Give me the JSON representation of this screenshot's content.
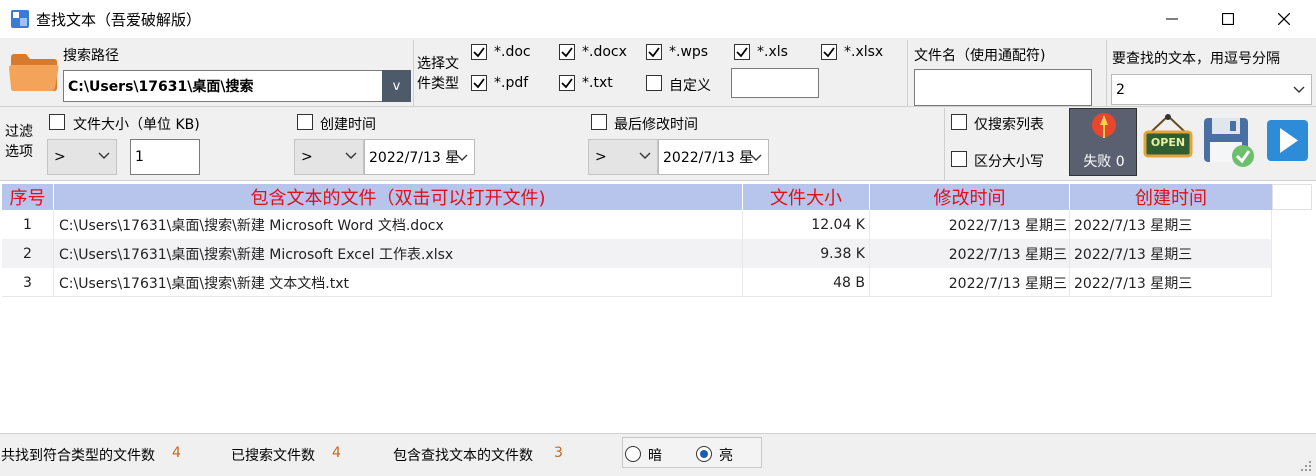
{
  "window": {
    "title": "查找文本（吾爱破解版）",
    "minimize": "—",
    "maximize": "☐",
    "close": "✕"
  },
  "search_path": {
    "label": "搜索路径",
    "value": "C:\\Users\\17631\\桌面\\搜索",
    "dropdown_label": "v"
  },
  "file_types": {
    "label": "选择文件类型",
    "items": [
      {
        "label": "*.doc",
        "checked": true
      },
      {
        "label": "*.docx",
        "checked": true
      },
      {
        "label": "*.wps",
        "checked": true
      },
      {
        "label": "*.xls",
        "checked": true
      },
      {
        "label": "*.xlsx",
        "checked": true
      },
      {
        "label": "*.pdf",
        "checked": true
      },
      {
        "label": "*.txt",
        "checked": true
      },
      {
        "label": "自定义",
        "checked": false
      }
    ],
    "custom_value": ""
  },
  "filename": {
    "label": "文件名（使用通配符)",
    "value": ""
  },
  "search_text": {
    "label": "要查找的文本，用逗号分隔",
    "value": "2"
  },
  "filters": {
    "label": "过滤选项",
    "size": {
      "label": "文件大小（单位 KB)",
      "checked": false,
      "op": ">",
      "value": "1"
    },
    "created": {
      "label": "创建时间",
      "checked": false,
      "op": ">",
      "value": "2022/7/13 星"
    },
    "modified": {
      "label": "最后修改时间",
      "checked": false,
      "op": ">",
      "value": "2022/7/13 星"
    },
    "only_list": {
      "label": "仅搜索列表",
      "checked": false
    },
    "case": {
      "label": "区分大小写",
      "checked": false
    }
  },
  "actions": {
    "fail_label": "失败 0",
    "open_label": "OPEN"
  },
  "table": {
    "headers": [
      "序号",
      "包含文本的文件（双击可以打开文件)",
      "文件大小",
      "修改时间",
      "创建时间"
    ],
    "rows": [
      [
        "1",
        "C:\\Users\\17631\\桌面\\搜索\\新建 Microsoft Word 文档.docx",
        "12.04 K",
        "2022/7/13 星期三",
        "2022/7/13 星期三"
      ],
      [
        "2",
        "C:\\Users\\17631\\桌面\\搜索\\新建 Microsoft Excel 工作表.xlsx",
        "9.38 K",
        "2022/7/13 星期三",
        "2022/7/13 星期三"
      ],
      [
        "3",
        "C:\\Users\\17631\\桌面\\搜索\\新建 文本文档.txt",
        "48 B",
        "2022/7/13 星期三",
        "2022/7/13 星期三"
      ]
    ]
  },
  "status": {
    "found_label": "共找到符合类型的文件数",
    "found_value": "4",
    "searched_label": "已搜索文件数",
    "searched_value": "4",
    "contains_label": "包含查找文本的文件数",
    "contains_value": "3",
    "theme_dark": "暗",
    "theme_light": "亮",
    "theme_selected": "亮"
  },
  "colors": {
    "header_bg": "#b7c5ec",
    "header_text": "#e0101a",
    "count_text": "#c46a1a"
  }
}
